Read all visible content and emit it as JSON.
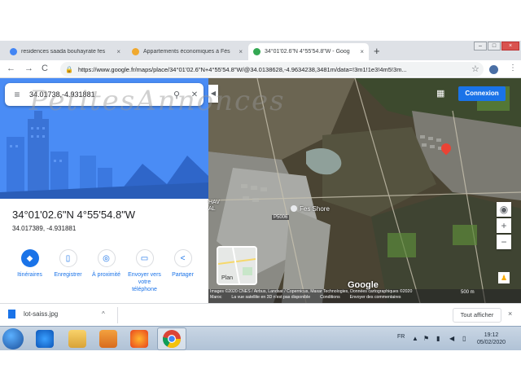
{
  "tabs": [
    {
      "title": "residences saada bouhayrate fes",
      "favicon_color": "#4285f4"
    },
    {
      "title": "Appartements économiques à Fès",
      "favicon_color": "#f0a92f"
    },
    {
      "title": "34°01'02.6\"N 4°55'54.8\"W - Goog",
      "favicon_color": "#34a853"
    }
  ],
  "browser": {
    "url": "https://www.google.fr/maps/place/34°01'02.6\"N+4°55'54.8\"W/@34.0138628,-4.9634238,3481m/data=!3m1!1e3!4m5!3m...",
    "new_tab": "+",
    "back": "←",
    "forward": "→",
    "reload": "C",
    "star": "☆",
    "menu": "⋮"
  },
  "panel": {
    "search_value": "34.01738,-4.931881",
    "search_icon": "search-icon",
    "coords_dms": "34°01'02.6\"N 4°55'54.8\"W",
    "coords_decimal": "34.017389, -4.931881",
    "actions": [
      {
        "label": "Itinéraires",
        "glyph": "◆",
        "style": "filled"
      },
      {
        "label": "Enregistrer",
        "glyph": "▯",
        "style": "outline"
      },
      {
        "label": "À proximité",
        "glyph": "◎",
        "style": "outline"
      },
      {
        "label": "Envoyer vers votre téléphone",
        "glyph": "▭",
        "style": "outline"
      },
      {
        "label": "Partager",
        "glyph": "<",
        "style": "outline"
      }
    ],
    "collapse": "◀"
  },
  "map": {
    "connexion": "Connexion",
    "road_label": "P5006",
    "place_label": "Fes Shore",
    "left_label": "HAV\nAL",
    "plan_label": "Plan",
    "google_logo": "Google",
    "attribution_1": "Images ©2020 CNES / Airbus, Landsat / Copernicus, Maxar Technologies, Données cartographiques ©2020",
    "attribution_2a": "Maroc",
    "attribution_2b": "La vue satellite en 3D n'est pas disponible",
    "attribution_2c": "Conditions",
    "attribution_2d": "Envoyer des commentaires",
    "scale": "500 m",
    "zoom_in": "+",
    "zoom_out": "−"
  },
  "watermark": "PetitesAnnonces",
  "downloads": {
    "file": "lot-saiss.jpg",
    "caret": "^",
    "show_all": "Tout afficher",
    "close": "×"
  },
  "taskbar": {
    "lang": "FR",
    "time": "19:12",
    "date": "05/02/2020"
  }
}
